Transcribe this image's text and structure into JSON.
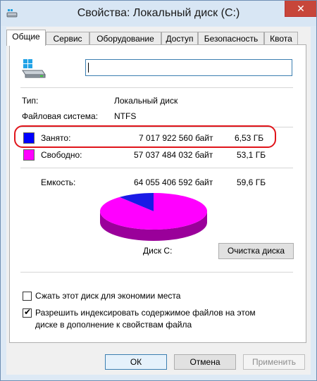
{
  "window": {
    "title": "Свойства: Локальный диск (C:)",
    "close_glyph": "✕"
  },
  "tabs": [
    {
      "label": "Общие",
      "active": true
    },
    {
      "label": "Сервис",
      "active": false
    },
    {
      "label": "Оборудование",
      "active": false
    },
    {
      "label": "Доступ",
      "active": false
    },
    {
      "label": "Безопасность",
      "active": false
    },
    {
      "label": "Квота",
      "active": false
    }
  ],
  "general": {
    "drive_icon": "drive-icon",
    "name_value": "",
    "type_label": "Тип:",
    "type_value": "Локальный диск",
    "fs_label": "Файловая система:",
    "fs_value": "NTFS"
  },
  "usage": {
    "used": {
      "label": "Занято:",
      "bytes": "7 017 922 560 байт",
      "size": "6,53 ГБ",
      "color": "#0000ff"
    },
    "free": {
      "label": "Свободно:",
      "bytes": "57 037 484 032 байт",
      "size": "53,1 ГБ",
      "color": "#ff00ff"
    },
    "capacity": {
      "label": "Емкость:",
      "bytes": "64 055 406 592 байт",
      "size": "59,6 ГБ"
    }
  },
  "disk": {
    "label": "Диск C:",
    "cleanup_button": "Очистка диска",
    "used_fraction": 0.1096
  },
  "options": {
    "compress": {
      "label": "Сжать этот диск для экономии места",
      "checked": false
    },
    "index_line1": "Разрешить индексировать содержимое файлов на этом",
    "index_line2": "диске в дополнение к свойствам файла",
    "index_checked": true,
    "check_glyph": "✔"
  },
  "buttons": {
    "ok": "ОК",
    "cancel": "Отмена",
    "apply": "Применить"
  }
}
